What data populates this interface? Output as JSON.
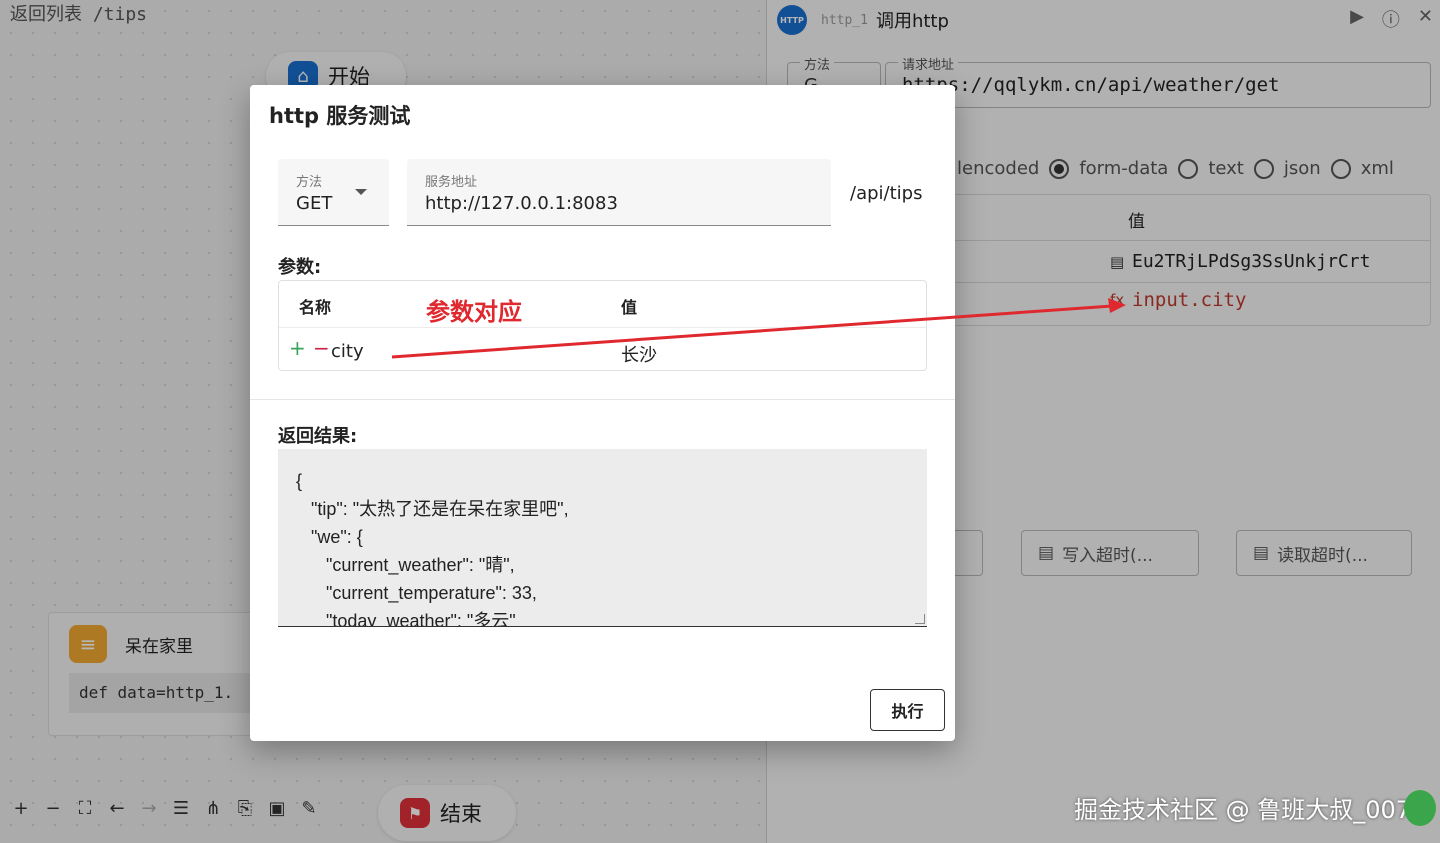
{
  "canvas": {
    "breadcrumb": "返回列表 /tips",
    "start_node": "开始",
    "end_node": "结束",
    "code_node": {
      "title": "呆在家里",
      "code": "def data=http_1."
    },
    "toolbar_icons": [
      "zoom-in",
      "zoom-out",
      "fit-view",
      "undo",
      "redo",
      "menu",
      "layout",
      "export",
      "save",
      "edit"
    ]
  },
  "panel": {
    "node_id": "http_1",
    "title": "调用http",
    "method_label": "方法",
    "method_value": "G",
    "url_label": "请求地址",
    "url_value": "https://qqlykm.cn/api/weather/get",
    "radio_options": [
      {
        "label": "lencoded",
        "selected": true
      },
      {
        "label": "form-data",
        "selected": false
      },
      {
        "label": "text",
        "selected": false
      },
      {
        "label": "json",
        "selected": false
      },
      {
        "label": "xml",
        "selected": false
      }
    ],
    "table_header": "值",
    "row1_value": "Eu2TRjLPdSg3SsUnkjrCrt",
    "row2_value": "input.city",
    "buttons": [
      "写入超时(...",
      "读取超时(..."
    ]
  },
  "modal": {
    "title": "http 服务测试",
    "method_label": "方法",
    "method_value": "GET",
    "url_label": "服务地址",
    "url_value": "http://127.0.0.1:8083",
    "path_suffix": "/api/tips",
    "params_label": "参数:",
    "col_name": "名称",
    "col_value": "值",
    "param_name": "city",
    "param_value": "长沙",
    "result_label": "返回结果:",
    "result_text": "{\n   \"tip\": \"太热了还是在呆在家里吧\",\n   \"we\": {\n      \"current_weather\": \"晴\",\n      \"current_temperature\": 33,\n      \"today_weather\": \"多云\"",
    "execute_label": "执行"
  },
  "annotation": "参数对应",
  "watermark": "掘金技术社区 @ 鲁班大叔_007"
}
